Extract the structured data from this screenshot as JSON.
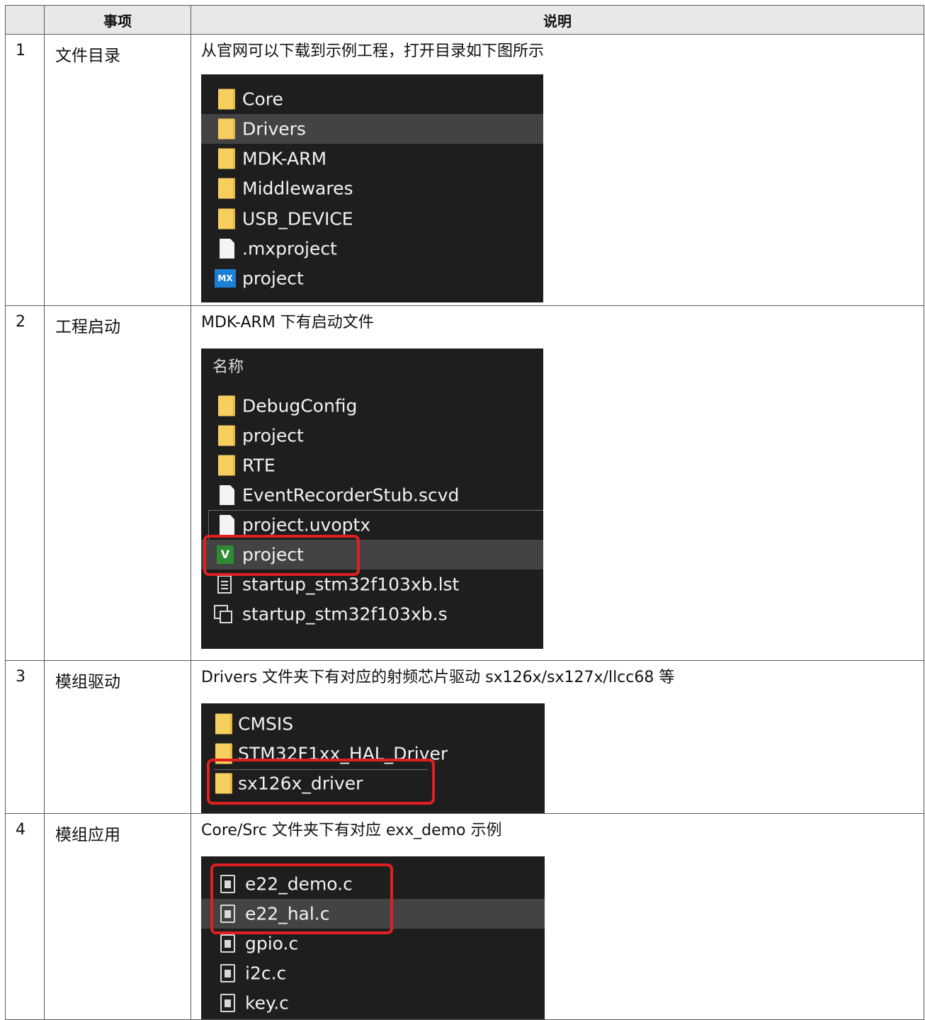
{
  "table": {
    "headers": {
      "num": "",
      "item": "事项",
      "desc": "说明"
    },
    "rows": [
      {
        "num": "1",
        "item": "文件目录",
        "desc": "从官网可以下载到示例工程，打开目录如下图所示",
        "files": [
          ".mxproject",
          "Core",
          "Drivers",
          "MDK-ARM",
          "Middlewares",
          "USB_DEVICE",
          "project"
        ]
      },
      {
        "num": "2",
        "item": "工程启动",
        "desc": "MDK-ARM 下有启动文件",
        "column_header": "名称",
        "files": [
          "DebugConfig",
          "project",
          "RTE",
          "EventRecorderStub.scvd",
          "project.uvoptx",
          "project",
          "startup_stm32f103xb.lst",
          "startup_stm32f103xb.s"
        ]
      },
      {
        "num": "3",
        "item": "模组驱动",
        "desc": "Drivers  文件夹下有对应的射频芯片驱动  sx126x/sx127x/llcc68  等",
        "files": [
          "CMSIS",
          "STM32F1xx_HAL_Driver",
          "sx126x_driver"
        ]
      },
      {
        "num": "4",
        "item": "模组应用",
        "desc": "Core/Src  文件夹下有对应  exx_demo  示例",
        "files": [
          "e22_demo.c",
          "e22_hal.c",
          "gpio.c",
          "i2c.c",
          "key.c"
        ]
      }
    ]
  },
  "colors": {
    "explorer_bg": "#1e1e1e",
    "selection": "#434343",
    "folder": "#f7cf5f",
    "highlight_box": "#e02020",
    "header_bg": "#e8e8e8"
  },
  "icons": {
    "folder": "folder-icon",
    "file": "file-icon",
    "mx": "stm32cubemx-icon",
    "keil": "keil-project-icon",
    "list": "list-file-icon",
    "asm": "assembly-file-icon",
    "c": "c-source-icon"
  }
}
